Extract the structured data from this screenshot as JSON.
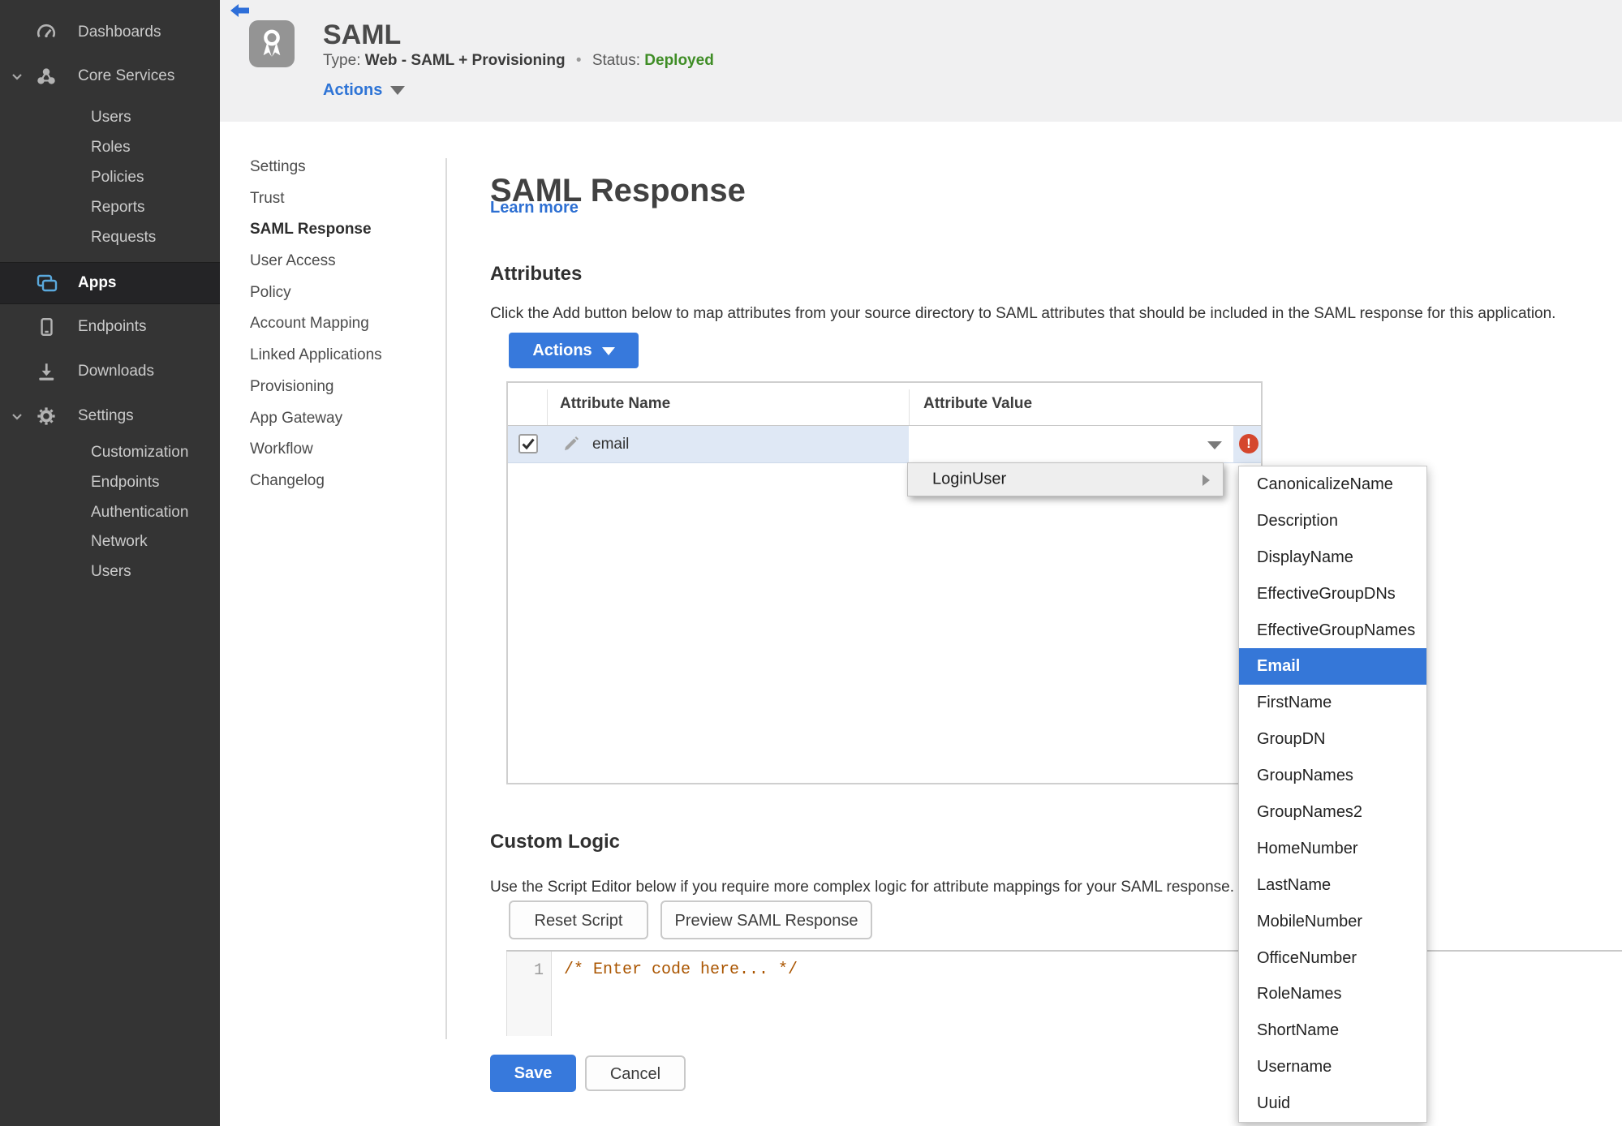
{
  "colors": {
    "accent_blue": "#3779dc",
    "link_blue": "#2d6fd2",
    "status_green": "#3f8d26",
    "error_red": "#d5472e",
    "selected_menu_blue": "#3577d8",
    "row_highlight": "#dfe8f5",
    "sidebar_bg": "#343434"
  },
  "sidebar": {
    "items": [
      {
        "label": "Dashboards",
        "icon": "gauge-icon"
      },
      {
        "label": "Core Services",
        "icon": "core-services-icon",
        "expanded": true
      },
      {
        "label": "Users"
      },
      {
        "label": "Roles"
      },
      {
        "label": "Policies"
      },
      {
        "label": "Reports"
      },
      {
        "label": "Requests"
      },
      {
        "label": "Apps",
        "icon": "apps-icon",
        "active": true
      },
      {
        "label": "Endpoints",
        "icon": "device-icon"
      },
      {
        "label": "Downloads",
        "icon": "download-icon"
      },
      {
        "label": "Settings",
        "icon": "gear-icon",
        "expanded": true
      },
      {
        "label": "Customization"
      },
      {
        "label": "Endpoints"
      },
      {
        "label": "Authentication"
      },
      {
        "label": "Network"
      },
      {
        "label": "Users"
      }
    ]
  },
  "header": {
    "title": "SAML",
    "type_label": "Type:",
    "type_value": "Web - SAML + Provisioning",
    "separator": "•",
    "status_label": "Status:",
    "status_value": "Deployed",
    "actions_label": "Actions"
  },
  "subnav": {
    "items": [
      {
        "label": "Settings"
      },
      {
        "label": "Trust"
      },
      {
        "label": "SAML Response",
        "selected": true
      },
      {
        "label": "User Access"
      },
      {
        "label": "Policy"
      },
      {
        "label": "Account Mapping"
      },
      {
        "label": "Linked Applications"
      },
      {
        "label": "Provisioning"
      },
      {
        "label": "App Gateway"
      },
      {
        "label": "Workflow"
      },
      {
        "label": "Changelog"
      }
    ]
  },
  "main": {
    "title": "SAML Response",
    "learn_more": "Learn more",
    "attributes": {
      "heading": "Attributes",
      "description": "Click the Add button below to map attributes from your source directory to SAML attributes that should be included in the SAML response for this application.",
      "actions_button": "Actions",
      "table": {
        "columns": [
          "Attribute Name",
          "Attribute Value"
        ],
        "row": {
          "checked": true,
          "name": "email",
          "value": ""
        }
      },
      "error_glyph": "!"
    },
    "value_menu": {
      "label": "LoginUser",
      "has_submenu": true
    },
    "submenu": {
      "items": [
        {
          "label": "CanonicalizeName"
        },
        {
          "label": "Description"
        },
        {
          "label": "DisplayName"
        },
        {
          "label": "EffectiveGroupDNs"
        },
        {
          "label": "EffectiveGroupNames"
        },
        {
          "label": "Email",
          "selected": true
        },
        {
          "label": "FirstName"
        },
        {
          "label": "GroupDN"
        },
        {
          "label": "GroupNames"
        },
        {
          "label": "GroupNames2"
        },
        {
          "label": "HomeNumber"
        },
        {
          "label": "LastName"
        },
        {
          "label": "MobileNumber"
        },
        {
          "label": "OfficeNumber"
        },
        {
          "label": "RoleNames"
        },
        {
          "label": "ShortName"
        },
        {
          "label": "Username"
        },
        {
          "label": "Uuid"
        }
      ]
    },
    "custom_logic": {
      "heading": "Custom Logic",
      "description": "Use the Script Editor below if you require more complex logic for attribute mappings for your SAML response.",
      "reset_button": "Reset Script",
      "preview_button": "Preview SAML Response",
      "editor": {
        "line_number": "1",
        "code": "/* Enter code here... */"
      }
    },
    "save_button": "Save",
    "cancel_button": "Cancel"
  }
}
